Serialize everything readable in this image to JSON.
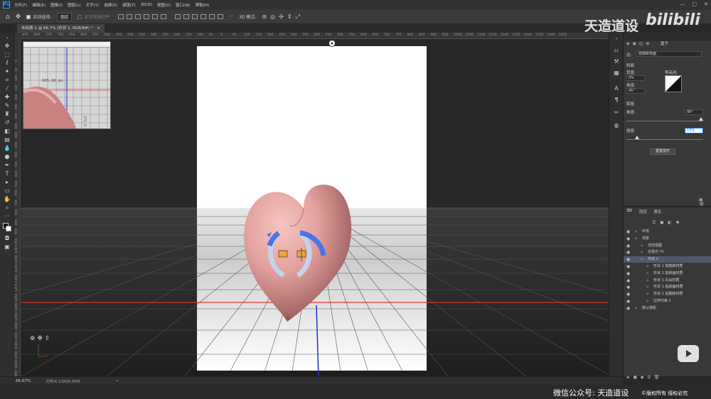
{
  "app": {
    "logo": "Ps",
    "menu": [
      "文件(F)",
      "编辑(E)",
      "图像(I)",
      "图层(L)",
      "文字(Y)",
      "选择(S)",
      "滤镜(T)",
      "3D(D)",
      "视图(V)",
      "窗口(W)",
      "帮助(H)"
    ],
    "window_buttons": [
      "—",
      "□",
      "✕"
    ]
  },
  "options_bar": {
    "auto_select_label": "自动选择:",
    "auto_select_value": "图层",
    "show_transform_label": "显示变换控件",
    "mode_label": "3D 模式:",
    "more": "···"
  },
  "document": {
    "tab_title": "未标题-1 @ 66.7% (形状 1, RGB/8#) *",
    "close": "×"
  },
  "ruler_h_labels": [
    "900",
    "850",
    "800",
    "750",
    "700",
    "650",
    "600",
    "550",
    "500",
    "450",
    "400",
    "350",
    "300",
    "250",
    "200",
    "150",
    "100",
    "50",
    "0",
    "50",
    "100",
    "150",
    "200",
    "250",
    "300",
    "350",
    "400",
    "450",
    "500",
    "550",
    "600",
    "650",
    "700",
    "750",
    "800",
    "850",
    "900",
    "950",
    "1000",
    "1050",
    "1100",
    "1150",
    "1200",
    "1250",
    "1300",
    "1350",
    "1400",
    "1450"
  ],
  "ruler_v_labels": [
    "0",
    "50",
    "100",
    "150",
    "200",
    "250",
    "300",
    "350",
    "400",
    "450",
    "500",
    "550",
    "600",
    "650",
    "700",
    "750",
    "800",
    "850",
    "900",
    "950",
    "1000",
    "1050",
    "1100",
    "1150",
    "1200",
    "1250",
    "1300",
    "1350",
    "1400",
    "1450",
    "1500",
    "1550",
    "1600",
    "1650",
    "1700"
  ],
  "navigator": {
    "measure_x": "605.66 px",
    "measure_y": "271.6"
  },
  "status": {
    "zoom": "66.67%",
    "doc_size": "文档:6.23M/6.85M",
    "arrow": ">"
  },
  "properties": {
    "title": "盖子",
    "preset_label": "边:",
    "preset_value": "前部和背面",
    "bevel_header": "斜面",
    "width_label": "宽度:",
    "width_value": "0%",
    "angle_label": "角度:",
    "angle_value": "45°",
    "contour_label": "等高线:",
    "inflate_header": "膨胀",
    "inflate_angle_label": "角度:",
    "inflate_angle_value": "90°",
    "strength_label": "强度:",
    "strength_value": "13%",
    "reset_button": "重置变形"
  },
  "layers": {
    "tabs": [
      "3D",
      "图层",
      "通道"
    ],
    "items": [
      {
        "label": "环境",
        "indent": 0
      },
      {
        "label": "场景",
        "indent": 0
      },
      {
        "label": "当前视图",
        "indent": 1
      },
      {
        "label": "无限光 *0",
        "indent": 1
      },
      {
        "label": "形状 1",
        "indent": 1,
        "selected": true
      },
      {
        "label": "形状 1 前膨胀材质",
        "indent": 2
      },
      {
        "label": "形状 1 前斜面材质",
        "indent": 2
      },
      {
        "label": "形状 1 凸出材质",
        "indent": 2
      },
      {
        "label": "形状 1 后斜面材质",
        "indent": 2
      },
      {
        "label": "形状 1 后膨胀材质",
        "indent": 2
      },
      {
        "label": "边界约束 1",
        "indent": 2
      },
      {
        "label": "默认相机",
        "indent": 0
      }
    ]
  },
  "watermark": {
    "top_text": "天造道设",
    "bili_text": "bilibili",
    "wechat": "微信公众号: 天造道设",
    "copyright": "©版权所有 侵权必究"
  },
  "icons": [
    "home-icon",
    "move-icon",
    "marquee-icon",
    "lasso-icon",
    "magic-wand-icon",
    "crop-icon",
    "eyedropper-icon",
    "healing-icon",
    "brush-icon",
    "stamp-icon",
    "eraser-icon",
    "gradient-icon",
    "blur-icon",
    "dodge-icon",
    "pen-icon",
    "type-icon",
    "path-select-icon",
    "shape-icon",
    "hand-icon",
    "zoom-icon",
    "more-tools-icon",
    "color-swatch-icon",
    "quick-mask-icon",
    "screen-mode-icon",
    "play-icon"
  ],
  "colors": {
    "accent": "#1473e6",
    "heart": "#d99a98",
    "gizmo_blue": "#4a74e8",
    "gizmo_orange": "#f0a23a"
  }
}
